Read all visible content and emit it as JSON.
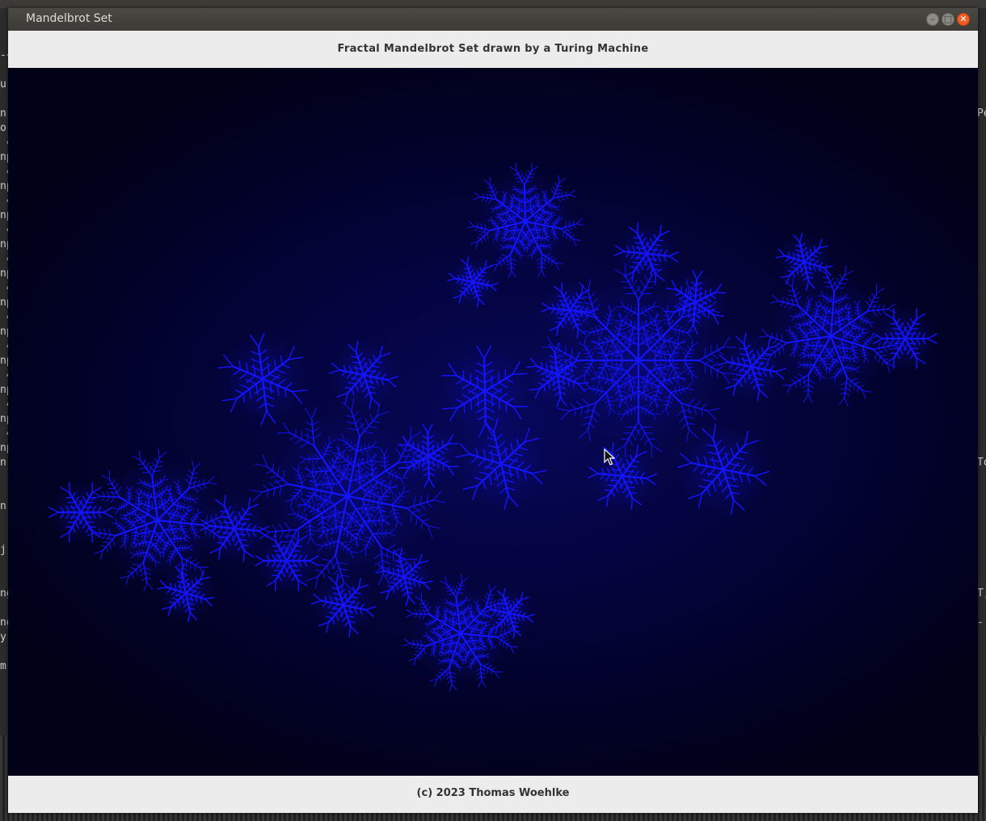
{
  "window": {
    "title": "Mandelbrot Set"
  },
  "header": {
    "title": "Fractal Mandelbrot Set drawn by a Turing Machine"
  },
  "footer": {
    "copyright": "(c) 2023 Thomas Woehlke"
  },
  "controls": {
    "minimize_icon": "minimize-icon",
    "maximize_icon": "maximize-icon",
    "close_icon": "close-icon"
  },
  "colors": {
    "fractal": "#1414ff",
    "background": "#02022a",
    "close_button": "#f15d22"
  },
  "background_terminal": {
    "left_chars": [
      "-+",
      "",
      "u",
      "",
      "n:",
      "or",
      " 4",
      "np",
      " 4",
      "np",
      " 4",
      "np",
      " 4",
      "np",
      " 4",
      "np",
      " 4",
      "np",
      " 4",
      "np",
      " 4",
      "np",
      " 4",
      "np",
      " 4",
      "np",
      " 4",
      "np",
      "n:",
      "",
      "",
      "n:",
      "",
      "",
      "j",
      "",
      "",
      "ng",
      "",
      "ng",
      "y-",
      "",
      "m"
    ],
    "right_chars": [
      "",
      "",
      "",
      "",
      "Pe",
      "",
      "",
      "",
      "",
      "",
      "",
      "",
      "",
      "",
      "",
      "",
      "",
      "",
      "",
      "",
      "",
      "",
      "",
      "",
      "",
      "",
      "",
      "",
      "To",
      "",
      "",
      "",
      "",
      "",
      "",
      "",
      "",
      "T,",
      "",
      "-",
      ""
    ]
  }
}
